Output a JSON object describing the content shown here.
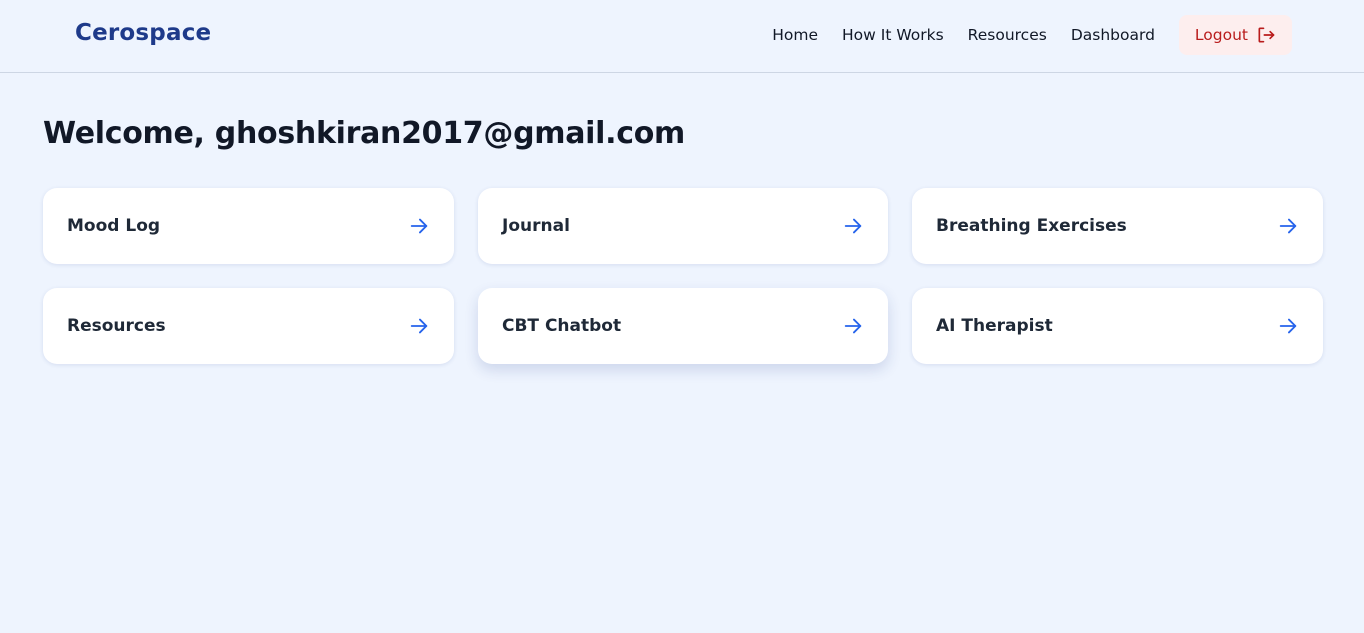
{
  "navbar": {
    "brand": "Cerospace",
    "links": [
      {
        "label": "Home"
      },
      {
        "label": "How It Works"
      },
      {
        "label": "Resources"
      },
      {
        "label": "Dashboard"
      }
    ],
    "logout_label": "Logout"
  },
  "main": {
    "welcome": "Welcome, ghoshkiran2017@gmail.com",
    "cards": [
      {
        "label": "Mood Log",
        "icon": "arrow-right-icon"
      },
      {
        "label": "Journal",
        "icon": "arrow-right-icon"
      },
      {
        "label": "Breathing Exercises",
        "icon": "arrow-right-icon"
      },
      {
        "label": "Resources",
        "icon": "arrow-right-icon"
      },
      {
        "label": "CBT Chatbot",
        "icon": "arrow-right-icon"
      },
      {
        "label": "AI Therapist",
        "icon": "arrow-right-icon"
      }
    ]
  },
  "colors": {
    "background": "#eef4fe",
    "brand": "#1e3a8a",
    "accent_arrow": "#2563eb",
    "logout_text": "#b91c1c",
    "logout_bg": "#fdeeee"
  }
}
